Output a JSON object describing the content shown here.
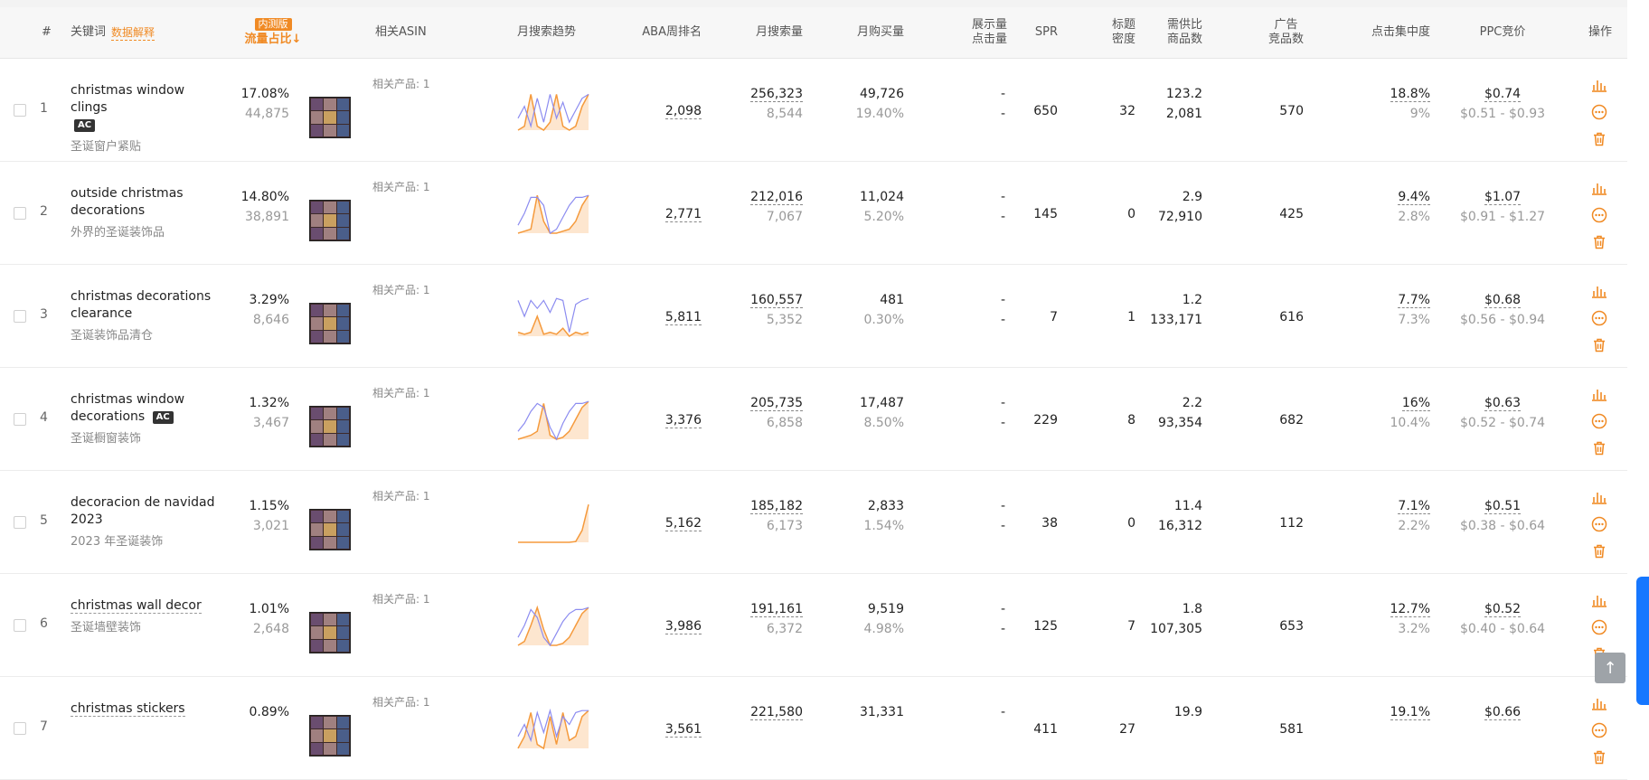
{
  "header": {
    "index": "#",
    "keyword": "关键词",
    "keyword_help": "数据解释",
    "beta_badge": "内测版",
    "traffic_share": "流量占比↓",
    "related_asin": "相关ASIN",
    "monthly_trend": "月搜索趋势",
    "aba_rank": "ABA周排名",
    "monthly_search": "月搜索量",
    "monthly_purchase": "月购买量",
    "impressions_l1": "展示量",
    "impressions_l2": "点击量",
    "spr": "SPR",
    "title_density_l1": "标题",
    "title_density_l2": "密度",
    "supply_l1": "需供比",
    "supply_l2": "商品数",
    "ad_l1": "广告",
    "ad_l2": "竞品数",
    "click_conc": "点击集中度",
    "ppc": "PPC竞价",
    "ops": "操作"
  },
  "rows": [
    {
      "idx": "1",
      "en1": "christmas window clings",
      "en2": "",
      "ac": "AC",
      "ac_line": 2,
      "cn": "圣诞窗户紧贴",
      "share": "17.08%",
      "share2": "44,875",
      "related": "相关产品: 1",
      "rank": "2,098",
      "search": "256,323",
      "search2": "8,544",
      "purchase": "49,726",
      "purchase2": "19.40%",
      "imp": "-",
      "clk": "-",
      "spr": "650",
      "density": "32",
      "supply": "123.2",
      "supply2": "2,081",
      "ads": "570",
      "conc": "18.8%",
      "conc2": "9%",
      "ppc": "$0.74",
      "ppc2": "$0.51 - $0.93",
      "trend_blue": [
        0.3,
        0.6,
        0.1,
        0.8,
        0.2,
        0.9,
        0.3,
        0.7,
        0.2,
        0.5,
        0.8,
        0.9
      ],
      "trend_orange": [
        0.0,
        0.1,
        0.9,
        0.1,
        0.0,
        0.2,
        0.9,
        0.1,
        0.0,
        0.1,
        0.6,
        0.9
      ]
    },
    {
      "idx": "2",
      "en1": "outside christmas",
      "en2": "decorations",
      "ac": "",
      "ac_line": 0,
      "cn": "外界的圣诞装饰品",
      "share": "14.80%",
      "share2": "38,891",
      "related": "相关产品: 1",
      "rank": "2,771",
      "search": "212,016",
      "search2": "7,067",
      "purchase": "11,024",
      "purchase2": "5.20%",
      "imp": "-",
      "clk": "-",
      "spr": "145",
      "density": "0",
      "supply": "2.9",
      "supply2": "72,910",
      "ads": "425",
      "conc": "9.4%",
      "conc2": "2.8%",
      "ppc": "$1.07",
      "ppc2": "$0.91 - $1.27",
      "trend_blue": [
        0.2,
        0.5,
        0.9,
        0.9,
        0.7,
        0.0,
        0.1,
        0.4,
        0.7,
        0.9,
        0.9,
        0.95
      ],
      "trend_orange": [
        0.0,
        0.05,
        0.1,
        0.95,
        0.3,
        0.0,
        0.0,
        0.05,
        0.1,
        0.3,
        0.7,
        0.95
      ]
    },
    {
      "idx": "3",
      "en1": "christmas decorations",
      "en2": "clearance",
      "ac": "",
      "ac_line": 0,
      "cn": "圣诞装饰品清仓",
      "share": "3.29%",
      "share2": "8,646",
      "related": "相关产品: 1",
      "rank": "5,811",
      "search": "160,557",
      "search2": "5,352",
      "purchase": "481",
      "purchase2": "0.30%",
      "imp": "-",
      "clk": "-",
      "spr": "7",
      "density": "1",
      "supply": "1.2",
      "supply2": "133,171",
      "ads": "616",
      "conc": "7.7%",
      "conc2": "7.3%",
      "ppc": "$0.68",
      "ppc2": "$0.56 - $0.94",
      "trend_blue": [
        0.9,
        0.5,
        0.9,
        0.7,
        0.9,
        0.6,
        0.95,
        0.9,
        0.1,
        0.8,
        0.9,
        0.95
      ],
      "trend_orange": [
        0.1,
        0.05,
        0.1,
        0.5,
        0.05,
        0.1,
        0.05,
        0.2,
        0.0,
        0.1,
        0.05,
        0.1
      ]
    },
    {
      "idx": "4",
      "en1": "christmas window",
      "en2": "decorations",
      "ac": "AC",
      "ac_line": 2,
      "cn": "圣诞橱窗装饰",
      "share": "1.32%",
      "share2": "3,467",
      "related": "相关产品: 1",
      "rank": "3,376",
      "search": "205,735",
      "search2": "6,858",
      "purchase": "17,487",
      "purchase2": "8.50%",
      "imp": "-",
      "clk": "-",
      "spr": "229",
      "density": "8",
      "supply": "2.2",
      "supply2": "93,354",
      "ads": "682",
      "conc": "16%",
      "conc2": "10.4%",
      "ppc": "$0.63",
      "ppc2": "$0.52 - $0.74",
      "trend_blue": [
        0.2,
        0.4,
        0.7,
        0.9,
        0.8,
        0.3,
        0.0,
        0.4,
        0.7,
        0.9,
        0.9,
        0.95
      ],
      "trend_orange": [
        0.0,
        0.05,
        0.1,
        0.2,
        0.9,
        0.1,
        0.0,
        0.05,
        0.2,
        0.5,
        0.8,
        0.95
      ]
    },
    {
      "idx": "5",
      "en1": "decoracion de navidad",
      "en2": "2023",
      "ac": "",
      "ac_line": 0,
      "cn": "2023 年圣诞装饰",
      "share": "1.15%",
      "share2": "3,021",
      "related": "相关产品: 1",
      "rank": "5,162",
      "search": "185,182",
      "search2": "6,173",
      "purchase": "2,833",
      "purchase2": "1.54%",
      "imp": "-",
      "clk": "-",
      "spr": "38",
      "density": "0",
      "supply": "11.4",
      "supply2": "16,312",
      "ads": "112",
      "conc": "7.1%",
      "conc2": "2.2%",
      "ppc": "$0.51",
      "ppc2": "$0.38 - $0.64",
      "trend_blue": [],
      "trend_orange": [
        0.0,
        0.0,
        0.0,
        0.0,
        0.0,
        0.0,
        0.0,
        0.0,
        0.0,
        0.02,
        0.3,
        0.95
      ]
    },
    {
      "idx": "6",
      "en1": "christmas wall decor",
      "en2": "",
      "ac": "",
      "ac_line": 0,
      "cn": "圣诞墙壁装饰",
      "share": "1.01%",
      "share2": "2,648",
      "related": "相关产品: 1",
      "rank": "3,986",
      "search": "191,161",
      "search2": "6,372",
      "purchase": "9,519",
      "purchase2": "4.98%",
      "imp": "-",
      "clk": "-",
      "spr": "125",
      "density": "7",
      "supply": "1.8",
      "supply2": "107,305",
      "ads": "653",
      "conc": "12.7%",
      "conc2": "3.2%",
      "ppc": "$0.52",
      "ppc2": "$0.40 - $0.64",
      "trend_blue": [
        0.2,
        0.5,
        0.9,
        0.7,
        0.2,
        0.0,
        0.3,
        0.6,
        0.8,
        0.9,
        0.9,
        0.95
      ],
      "trend_orange": [
        0.0,
        0.1,
        0.5,
        0.95,
        0.4,
        0.0,
        0.0,
        0.05,
        0.2,
        0.5,
        0.8,
        0.95
      ]
    },
    {
      "idx": "7",
      "en1": "christmas stickers",
      "en2": "",
      "ac": "",
      "ac_line": 0,
      "cn": "",
      "share": "0.89%",
      "share2": "",
      "related": "相关产品: 1",
      "rank": "3,561",
      "search": "221,580",
      "search2": "",
      "purchase": "31,331",
      "purchase2": "",
      "imp": "-",
      "clk": "",
      "spr": "411",
      "density": "27",
      "supply": "19.9",
      "supply2": "",
      "ads": "581",
      "conc": "19.1%",
      "conc2": "",
      "ppc": "$0.66",
      "ppc2": "",
      "trend_blue": [
        0.3,
        0.6,
        0.2,
        0.9,
        0.4,
        0.95,
        0.3,
        0.8,
        0.6,
        0.9,
        0.95,
        0.95
      ],
      "trend_orange": [
        0.0,
        0.3,
        0.9,
        0.1,
        0.0,
        0.8,
        0.1,
        0.9,
        0.2,
        0.3,
        0.8,
        0.95
      ]
    }
  ],
  "colors": {
    "accent": "#f08a24",
    "trend_blue": "#8c8cf0",
    "trend_orange": "#f59a3c"
  }
}
